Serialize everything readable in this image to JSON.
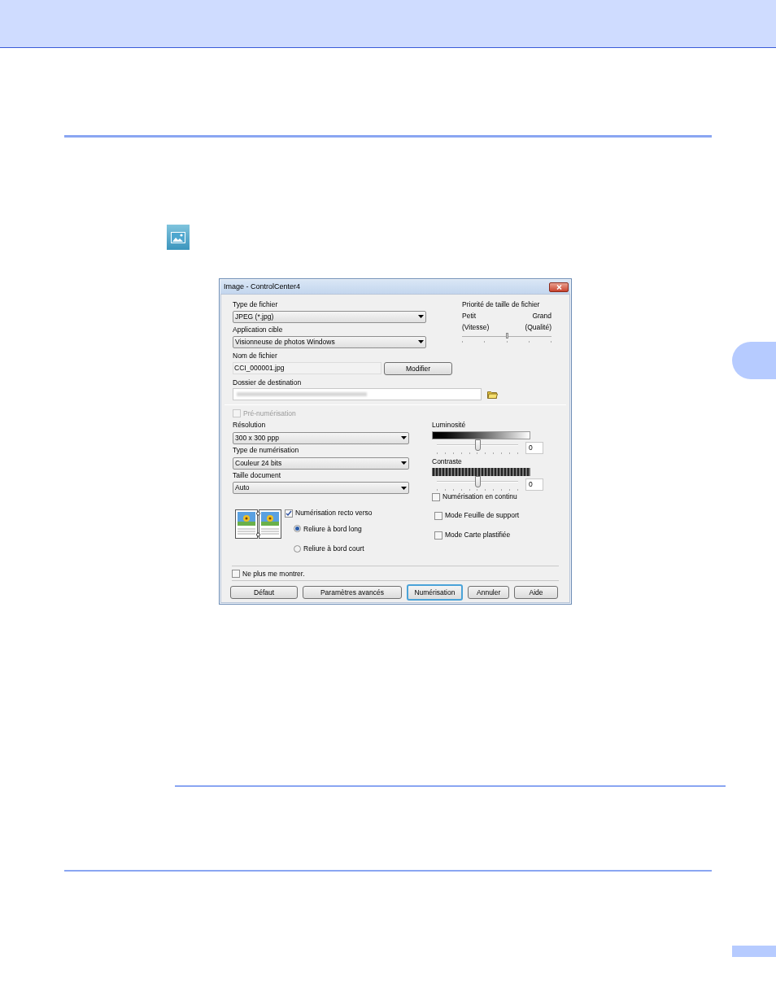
{
  "dialog": {
    "title": "Image - ControlCenter4",
    "file_type": {
      "label": "Type de fichier",
      "value": "JPEG (*.jpg)"
    },
    "target_app": {
      "label": "Application cible",
      "value": "Visionneuse de photos Windows"
    },
    "file_name": {
      "label": "Nom de fichier",
      "value": "CCI_000001.jpg"
    },
    "modify_button": "Modifier",
    "destination": {
      "label": "Dossier de destination"
    },
    "size_priority": {
      "title": "Priorité de taille de fichier",
      "left_top": "Petit",
      "left_bottom": "(Vitesse)",
      "right_top": "Grand",
      "right_bottom": "(Qualité)",
      "level": 0.5
    },
    "pre_scan": {
      "label": "Pré-numérisation",
      "checked": false,
      "disabled": true
    },
    "resolution": {
      "label": "Résolution",
      "value": "300 x 300 ppp"
    },
    "scan_type": {
      "label": "Type de numérisation",
      "value": "Couleur 24 bits"
    },
    "document_size": {
      "label": "Taille document",
      "value": "Auto"
    },
    "brightness": {
      "label": "Luminosité",
      "level": 0.5,
      "value": "0"
    },
    "contrast": {
      "label": "Contraste",
      "level": 0.5,
      "value": "0"
    },
    "continuous_scan": {
      "label": "Numérisation en continu",
      "checked": false
    },
    "duplex": {
      "label": "Numérisation recto verso",
      "checked": true
    },
    "binding": [
      {
        "label": "Reliure à bord long",
        "selected": true
      },
      {
        "label": "Reliure à bord court",
        "selected": false
      }
    ],
    "carrier_sheet": {
      "label": "Mode Feuille de support",
      "checked": false
    },
    "plastic_card": {
      "label": "Mode Carte plastifiée",
      "checked": false
    },
    "dont_show": {
      "label": "Ne plus me montrer.",
      "checked": false
    },
    "buttons": [
      {
        "label": "Défaut",
        "default": false
      },
      {
        "label": "Paramètres avancés",
        "default": false
      },
      {
        "label": "Numérisation",
        "default": true
      },
      {
        "label": "Annuler",
        "default": false
      },
      {
        "label": "Aide",
        "default": false
      }
    ]
  }
}
